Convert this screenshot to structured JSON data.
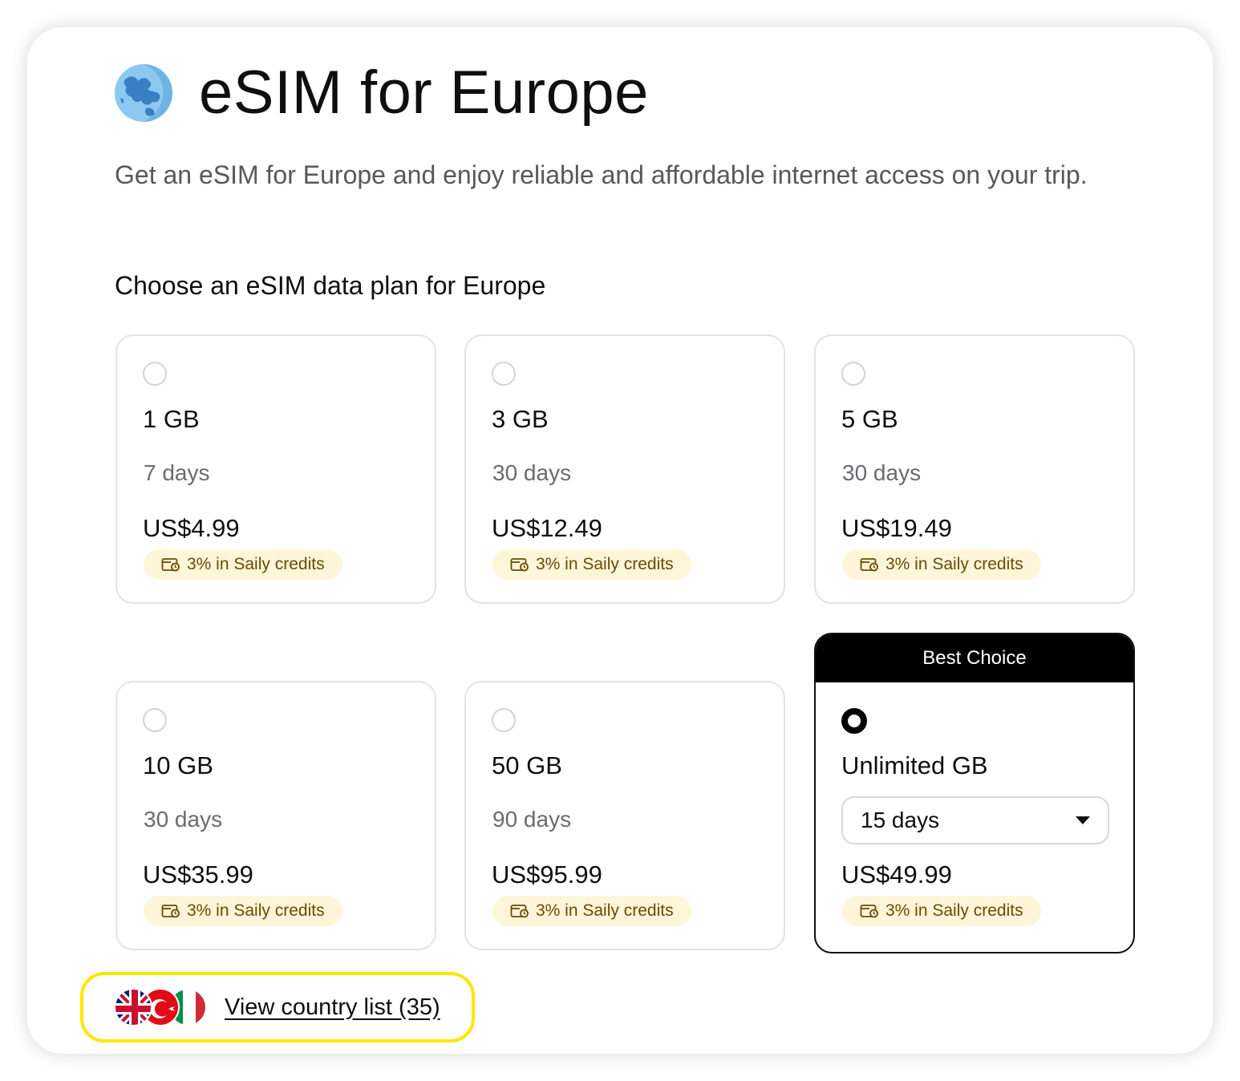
{
  "header": {
    "title": "eSIM for Europe",
    "globe_icon": "globe-europe-icon"
  },
  "intro": {
    "subtitle": "Get an eSIM for Europe and enjoy reliable and affordable internet access on your trip."
  },
  "plans_section": {
    "title": "Choose an eSIM data plan for Europe"
  },
  "plans": [
    {
      "data": "1 GB",
      "duration": "7 days",
      "price": "US$4.99",
      "credits": "3% in Saily credits",
      "selected": false
    },
    {
      "data": "3 GB",
      "duration": "30 days",
      "price": "US$12.49",
      "credits": "3% in Saily credits",
      "selected": false
    },
    {
      "data": "5 GB",
      "duration": "30 days",
      "price": "US$19.49",
      "credits": "3% in Saily credits",
      "selected": false
    },
    {
      "data": "10 GB",
      "duration": "30 days",
      "price": "US$35.99",
      "credits": "3% in Saily credits",
      "selected": false
    },
    {
      "data": "50 GB",
      "duration": "90 days",
      "price": "US$95.99",
      "credits": "3% in Saily credits",
      "selected": false
    }
  ],
  "best_plan": {
    "badge": "Best Choice",
    "data": "Unlimited GB",
    "duration_selected": "15 days",
    "price": "US$49.99",
    "credits": "3% in Saily credits",
    "selected": true
  },
  "country_list": {
    "link_text": "View country list (35)",
    "flags": [
      "uk-flag-icon",
      "turkey-flag-icon",
      "italy-flag-icon"
    ]
  },
  "colors": {
    "accent_yellow": "#ffe600",
    "credits_bg": "#fff5d9",
    "credits_text": "#6a4c00",
    "badge_bg": "#000000"
  }
}
